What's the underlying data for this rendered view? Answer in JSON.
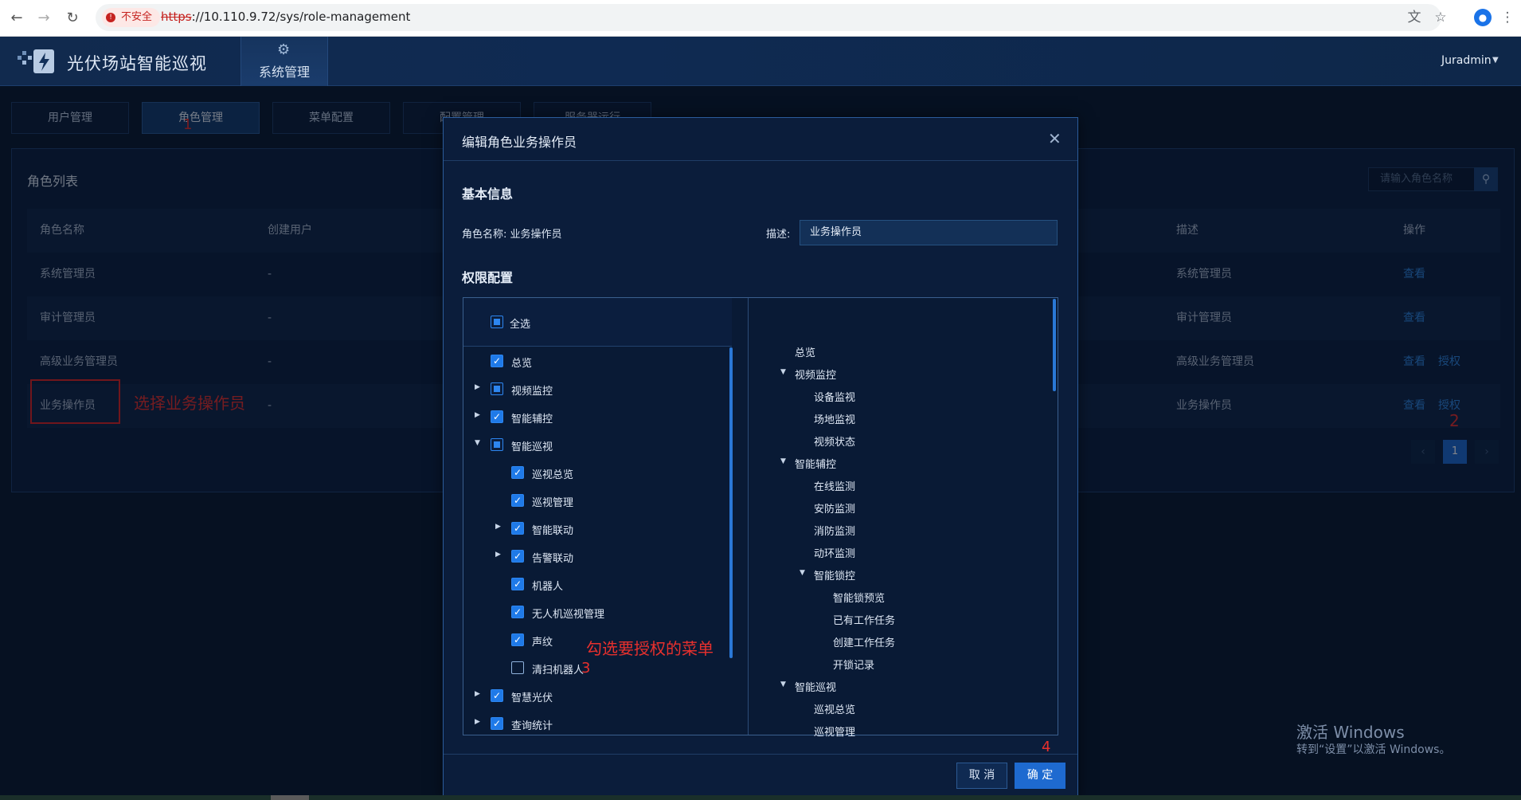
{
  "browser": {
    "insecure_label": "不安全",
    "url_scheme": "https",
    "url_rest": "://10.110.9.72/sys/role-management"
  },
  "app": {
    "title": "光伏场站智能巡视",
    "module": "系统管理",
    "user": "Juradmin"
  },
  "tabs": [
    "用户管理",
    "角色管理",
    "菜单配置",
    "配置管理",
    "服务器运行"
  ],
  "role_list": {
    "title": "角色列表",
    "search_placeholder": "请输入角色名称",
    "columns": {
      "name": "角色名称",
      "creator": "创建用户",
      "desc": "描述",
      "action": "操作"
    },
    "rows": [
      {
        "name": "系统管理员",
        "creator": "-",
        "desc": "系统管理员",
        "view": "查看",
        "grant": ""
      },
      {
        "name": "审计管理员",
        "creator": "-",
        "desc": "审计管理员",
        "view": "查看",
        "grant": ""
      },
      {
        "name": "高级业务管理员",
        "creator": "-",
        "desc": "高级业务管理员",
        "view": "查看",
        "grant": "授权"
      },
      {
        "name": "业务操作员",
        "creator": "-",
        "desc": "业务操作员",
        "view": "查看",
        "grant": "授权"
      }
    ],
    "page": "1"
  },
  "annotations": {
    "n1": "1",
    "n2": "2",
    "n3": "3",
    "n4": "4",
    "select_role": "选择业务操作员",
    "check_menu": "勾选要授权的菜单"
  },
  "modal": {
    "title": "编辑角色业务操作员",
    "basic_info": "基本信息",
    "role_name_label": "角色名称:",
    "role_name_value": "业务操作员",
    "desc_label": "描述:",
    "desc_value": "业务操作员",
    "perm_config": "权限配置",
    "select_all": "全选",
    "cancel": "取 消",
    "ok": "确 定"
  },
  "left_tree": [
    {
      "label": "总览",
      "state": "checked",
      "arrow": ""
    },
    {
      "label": "视频监控",
      "state": "partial",
      "arrow": "collapsed"
    },
    {
      "label": "智能辅控",
      "state": "checked",
      "arrow": "collapsed"
    },
    {
      "label": "智能巡视",
      "state": "partial",
      "arrow": "expanded"
    },
    {
      "label": "巡视总览",
      "state": "checked",
      "arrow": ""
    },
    {
      "label": "巡视管理",
      "state": "checked",
      "arrow": ""
    },
    {
      "label": "智能联动",
      "state": "checked",
      "arrow": "collapsed"
    },
    {
      "label": "告警联动",
      "state": "checked",
      "arrow": "collapsed"
    },
    {
      "label": "机器人",
      "state": "checked",
      "arrow": ""
    },
    {
      "label": "无人机巡视管理",
      "state": "checked",
      "arrow": ""
    },
    {
      "label": "声纹",
      "state": "checked",
      "arrow": ""
    },
    {
      "label": "清扫机器人",
      "state": "unchecked",
      "arrow": ""
    },
    {
      "label": "智慧光伏",
      "state": "checked",
      "arrow": "collapsed"
    },
    {
      "label": "查询统计",
      "state": "checked",
      "arrow": "collapsed"
    }
  ],
  "right_tree": [
    {
      "label": "总览",
      "arrow": ""
    },
    {
      "label": "视频监控",
      "arrow": "expanded"
    },
    {
      "label": "设备监视",
      "arrow": ""
    },
    {
      "label": "场地监视",
      "arrow": ""
    },
    {
      "label": "视频状态",
      "arrow": ""
    },
    {
      "label": "智能辅控",
      "arrow": "expanded"
    },
    {
      "label": "在线监测",
      "arrow": ""
    },
    {
      "label": "安防监测",
      "arrow": ""
    },
    {
      "label": "消防监测",
      "arrow": ""
    },
    {
      "label": "动环监测",
      "arrow": ""
    },
    {
      "label": "智能锁控",
      "arrow": "expanded"
    },
    {
      "label": "智能锁预览",
      "arrow": ""
    },
    {
      "label": "已有工作任务",
      "arrow": ""
    },
    {
      "label": "创建工作任务",
      "arrow": ""
    },
    {
      "label": "开锁记录",
      "arrow": ""
    },
    {
      "label": "智能巡视",
      "arrow": "expanded"
    },
    {
      "label": "巡视总览",
      "arrow": ""
    },
    {
      "label": "巡视管理",
      "arrow": ""
    }
  ],
  "watermark": {
    "line1": "激活 Windows",
    "line2": "转到“设置”以激活 Windows。"
  },
  "colors": {
    "accent": "#1e6ad0",
    "annotation": "#e8302d",
    "background": "#0b1a31"
  }
}
